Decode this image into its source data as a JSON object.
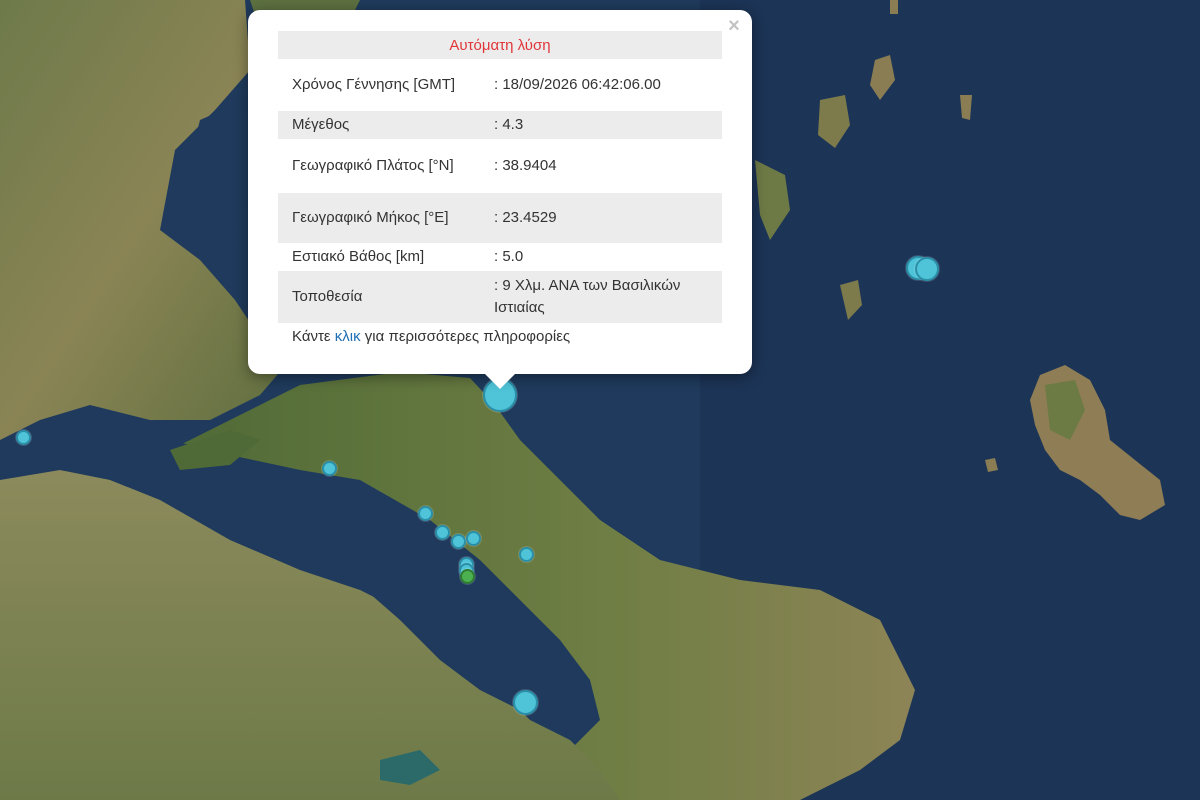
{
  "popup": {
    "title": "Αυτόματη λύση",
    "rows": [
      {
        "label": "Χρόνος Γέννησης [GMT]",
        "value": ": 18/09/2026 06:42:06.00"
      },
      {
        "label": "Μέγεθος",
        "value": ": 4.3"
      },
      {
        "label": "Γεωγραφικό Πλάτος [°N]",
        "value": ": 38.9404"
      },
      {
        "label": "Γεωγραφικό Μήκος [°E]",
        "value": ": 23.4529"
      },
      {
        "label": "Εστιακό Βάθος [km]",
        "value": ": 5.0"
      },
      {
        "label": "Τοποθεσία",
        "value": ": 9 Χλμ. ΑΝΑ των Βασιλικών Ιστιαίας"
      }
    ],
    "footer_prefix": "Κάντε",
    "footer_link": "κλικ",
    "footer_suffix": "για περισσότερες πληροφορίες",
    "close_symbol": "×"
  },
  "map": {
    "sea_color": "#1f3a5c",
    "marker_color": "#4fc3d7",
    "marker_green_color": "#4caf50"
  }
}
